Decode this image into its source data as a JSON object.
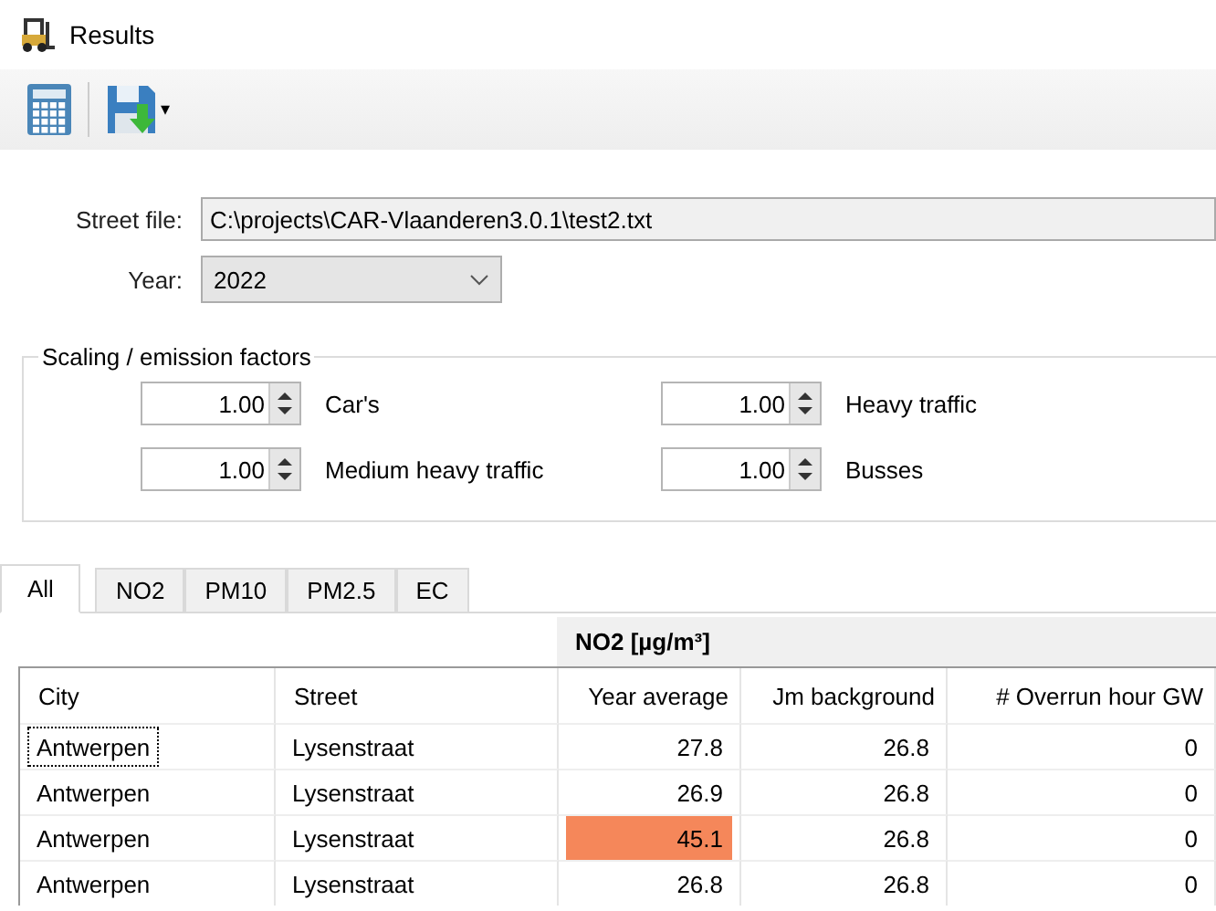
{
  "window": {
    "title": "Results"
  },
  "toolbar": {
    "dropdown_caret": "▾"
  },
  "street_file": {
    "label": "Street file:",
    "value": "C:\\projects\\CAR-Vlaanderen3.0.1\\test2.txt"
  },
  "year": {
    "label": "Year:",
    "value": "2022"
  },
  "scaling": {
    "title": "Scaling / emission factors",
    "factors": [
      {
        "value": "1.00",
        "label": "Car's"
      },
      {
        "value": "1.00",
        "label": "Heavy traffic"
      },
      {
        "value": "1.00",
        "label": "Medium heavy traffic"
      },
      {
        "value": "1.00",
        "label": "Busses"
      }
    ]
  },
  "tabs": [
    {
      "label": "All",
      "selected": true
    },
    {
      "label": "NO2",
      "selected": false
    },
    {
      "label": "PM10",
      "selected": false
    },
    {
      "label": "PM2.5",
      "selected": false
    },
    {
      "label": "EC",
      "selected": false
    }
  ],
  "table": {
    "band": "NO2 [µg/m³]",
    "columns": [
      "City",
      "Street",
      "Year average",
      "Jm background",
      "# Overrun hour GW"
    ],
    "rows": [
      {
        "city": "Antwerpen",
        "street": "Lysenstraat",
        "year_average": "27.8",
        "jm_background": "26.8",
        "overrun": "0",
        "focused": true,
        "exceeded": false
      },
      {
        "city": "Antwerpen",
        "street": "Lysenstraat",
        "year_average": "26.9",
        "jm_background": "26.8",
        "overrun": "0",
        "focused": false,
        "exceeded": false
      },
      {
        "city": "Antwerpen",
        "street": "Lysenstraat",
        "year_average": "45.1",
        "jm_background": "26.8",
        "overrun": "0",
        "focused": false,
        "exceeded": true
      },
      {
        "city": "Antwerpen",
        "street": "Lysenstraat",
        "year_average": "26.8",
        "jm_background": "26.8",
        "overrun": "0",
        "focused": false,
        "exceeded": false
      }
    ]
  }
}
